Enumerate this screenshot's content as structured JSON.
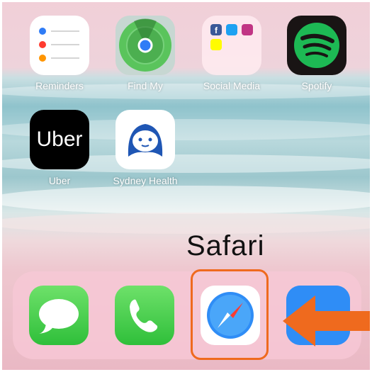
{
  "home_screen": {
    "row1": [
      {
        "label": "Reminders",
        "icon": "reminders-icon"
      },
      {
        "label": "Find My",
        "icon": "find-my-icon"
      },
      {
        "label": "Social Media",
        "icon": "folder-icon"
      },
      {
        "label": "Spotify",
        "icon": "spotify-icon"
      }
    ],
    "row2": [
      {
        "label": "Uber",
        "icon": "uber-icon",
        "logo_text": "Uber"
      },
      {
        "label": "Sydney Health",
        "icon": "sydney-health-icon"
      }
    ]
  },
  "dock": [
    {
      "name": "Messages",
      "icon": "messages-icon"
    },
    {
      "name": "Phone",
      "icon": "phone-icon"
    },
    {
      "name": "Safari",
      "icon": "safari-icon"
    },
    {
      "name": "App",
      "icon": "app-icon"
    }
  ],
  "annotation": {
    "caption": "Safari",
    "highlight_color": "#ef6a1e",
    "arrow_color": "#ef6a1e",
    "arrow_icon": "arrow-left-icon"
  }
}
